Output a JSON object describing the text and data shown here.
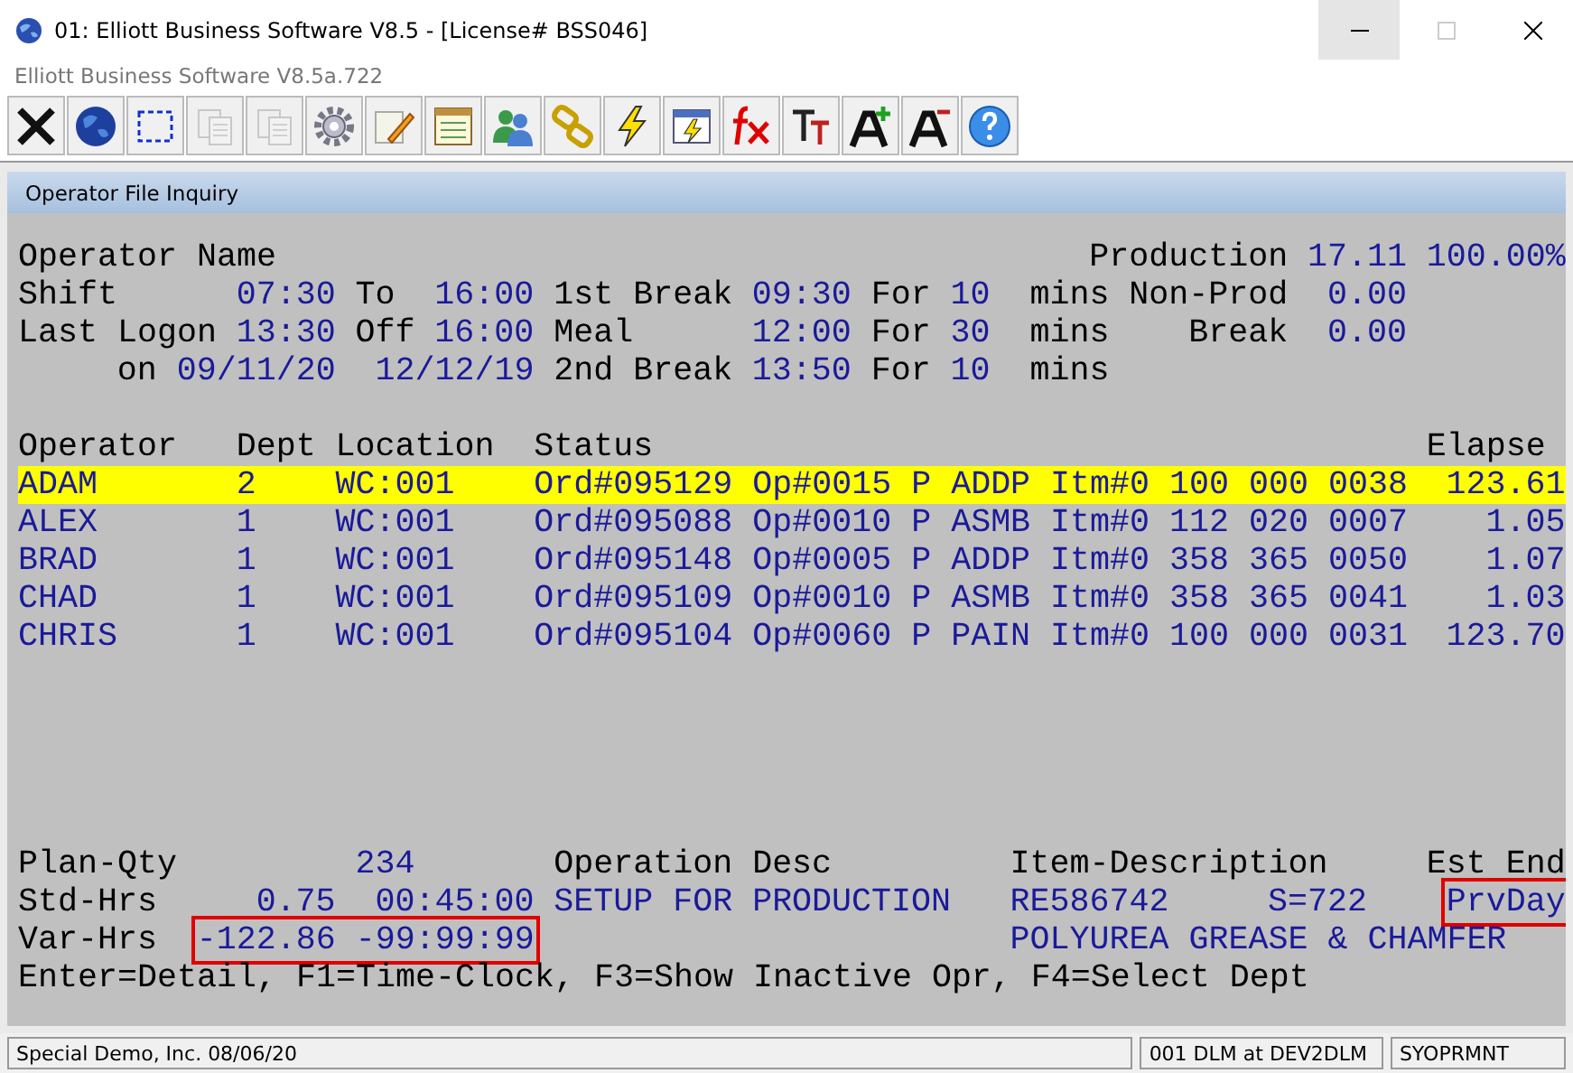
{
  "window": {
    "title": "01: Elliott Business Software V8.5 - [License# BSS046]",
    "subtitle": "Elliott Business Software V8.5a.722"
  },
  "toolbar": [
    {
      "kind": "close",
      "disabled": false
    },
    {
      "kind": "globe",
      "disabled": false
    },
    {
      "kind": "select",
      "disabled": false
    },
    {
      "kind": "copy",
      "disabled": true
    },
    {
      "kind": "paste",
      "disabled": true
    },
    {
      "kind": "gear",
      "disabled": false
    },
    {
      "kind": "edit",
      "disabled": false
    },
    {
      "kind": "notebook",
      "disabled": false
    },
    {
      "kind": "users",
      "disabled": false
    },
    {
      "kind": "chain",
      "disabled": false
    },
    {
      "kind": "bolt",
      "disabled": false
    },
    {
      "kind": "windowbolt",
      "disabled": false
    },
    {
      "kind": "fx",
      "disabled": false
    },
    {
      "kind": "tt",
      "disabled": false
    },
    {
      "kind": "aplus",
      "disabled": false
    },
    {
      "kind": "aminus",
      "disabled": false
    },
    {
      "kind": "help",
      "disabled": false
    }
  ],
  "panel": {
    "title": "Operator File Inquiry"
  },
  "summary_lines": [
    [
      {
        "text": "Operator Name",
        "kind": "label"
      },
      {
        "text": "Production",
        "kind": "label"
      },
      {
        "text": "17.11",
        "kind": "value"
      },
      {
        "text": "100.00%",
        "kind": "value"
      }
    ],
    [
      {
        "text": "Shift",
        "kind": "label"
      },
      {
        "text": "07:30",
        "kind": "value"
      },
      {
        "text": "To",
        "kind": "label"
      },
      {
        "text": "16:00",
        "kind": "value"
      },
      {
        "text": "1st Break",
        "kind": "label"
      },
      {
        "text": "09:30",
        "kind": "value"
      },
      {
        "text": "For",
        "kind": "label"
      },
      {
        "text": "10",
        "kind": "value"
      },
      {
        "text": "mins",
        "kind": "label"
      },
      {
        "text": "Non-Prod",
        "kind": "label"
      },
      {
        "text": "0.00",
        "kind": "value"
      }
    ],
    [
      {
        "text": "Last Logon",
        "kind": "label"
      },
      {
        "text": "13:30",
        "kind": "value"
      },
      {
        "text": "Off",
        "kind": "label"
      },
      {
        "text": "16:00",
        "kind": "value"
      },
      {
        "text": "Meal",
        "kind": "label"
      },
      {
        "text": "12:00",
        "kind": "value"
      },
      {
        "text": "For",
        "kind": "label"
      },
      {
        "text": "30",
        "kind": "value"
      },
      {
        "text": "mins",
        "kind": "label"
      },
      {
        "text": "Break",
        "kind": "label"
      },
      {
        "text": "0.00",
        "kind": "value"
      }
    ],
    [
      {
        "text": "on",
        "kind": "label"
      },
      {
        "text": "09/11/20",
        "kind": "value"
      },
      {
        "text": "12/12/19",
        "kind": "value"
      },
      {
        "text": "2nd Break",
        "kind": "label"
      },
      {
        "text": "13:50",
        "kind": "value"
      },
      {
        "text": "For",
        "kind": "label"
      },
      {
        "text": "10",
        "kind": "value"
      },
      {
        "text": "mins",
        "kind": "label"
      }
    ]
  ],
  "table": {
    "columns": [
      "Operator",
      "Dept",
      "Location",
      "Status",
      "Elapse"
    ],
    "rows": [
      {
        "operator": "ADAM",
        "dept": "2",
        "location": "WC:001",
        "status": "Ord#095129 Op#0015 P ADDP Itm#0 100 000 0038",
        "elapse": "123.61",
        "selected": true
      },
      {
        "operator": "ALEX",
        "dept": "1",
        "location": "WC:001",
        "status": "Ord#095088 Op#0010 P ASMB Itm#0 112 020 0007",
        "elapse": "1.05",
        "selected": false
      },
      {
        "operator": "BRAD",
        "dept": "1",
        "location": "WC:001",
        "status": "Ord#095148 Op#0005 P ADDP Itm#0 358 365 0050",
        "elapse": "1.07",
        "selected": false
      },
      {
        "operator": "CHAD",
        "dept": "1",
        "location": "WC:001",
        "status": "Ord#095109 Op#0010 P ASMB Itm#0 358 365 0041",
        "elapse": "1.03",
        "selected": false
      },
      {
        "operator": "CHRIS",
        "dept": "1",
        "location": "WC:001",
        "status": "Ord#095104 Op#0060 P PAIN Itm#0 100 000 0031",
        "elapse": "123.70",
        "selected": false
      }
    ]
  },
  "detail_lines": [
    [
      {
        "text": "Plan-Qty",
        "kind": "label",
        "flagged": false
      },
      {
        "text": "234",
        "kind": "value",
        "flagged": false
      },
      {
        "text": "Operation Desc",
        "kind": "label",
        "flagged": false
      },
      {
        "text": "Item-Description",
        "kind": "label",
        "flagged": false
      },
      {
        "text": "Est End",
        "kind": "label",
        "flagged": false
      }
    ],
    [
      {
        "text": "Std-Hrs",
        "kind": "label",
        "flagged": false
      },
      {
        "text": "0.75",
        "kind": "value",
        "flagged": false
      },
      {
        "text": "00:45:00",
        "kind": "value",
        "flagged": false
      },
      {
        "text": "SETUP FOR PRODUCTION",
        "kind": "value",
        "flagged": false
      },
      {
        "text": "RE586742",
        "kind": "value",
        "flagged": false
      },
      {
        "text": "S=722",
        "kind": "value",
        "flagged": false
      },
      {
        "text": "PrvDay",
        "kind": "value",
        "flagged": true
      }
    ],
    [
      {
        "text": "Var-Hrs",
        "kind": "label",
        "flagged": false
      },
      {
        "text": "-122.86 -99:99:99",
        "kind": "value",
        "flagged": true
      },
      {
        "text": "POLYUREA GREASE & CHAMFER",
        "kind": "value",
        "flagged": false
      }
    ],
    [
      {
        "text": "Enter=Detail, F1=Time-Clock, F3=Show Inactive Opr, F4=Select Dept",
        "kind": "label",
        "flagged": false
      }
    ]
  ],
  "status_bar": [
    "Special Demo, Inc. 08/06/20",
    "001 DLM at DEV2DLM",
    "SYOPRMNT"
  ]
}
